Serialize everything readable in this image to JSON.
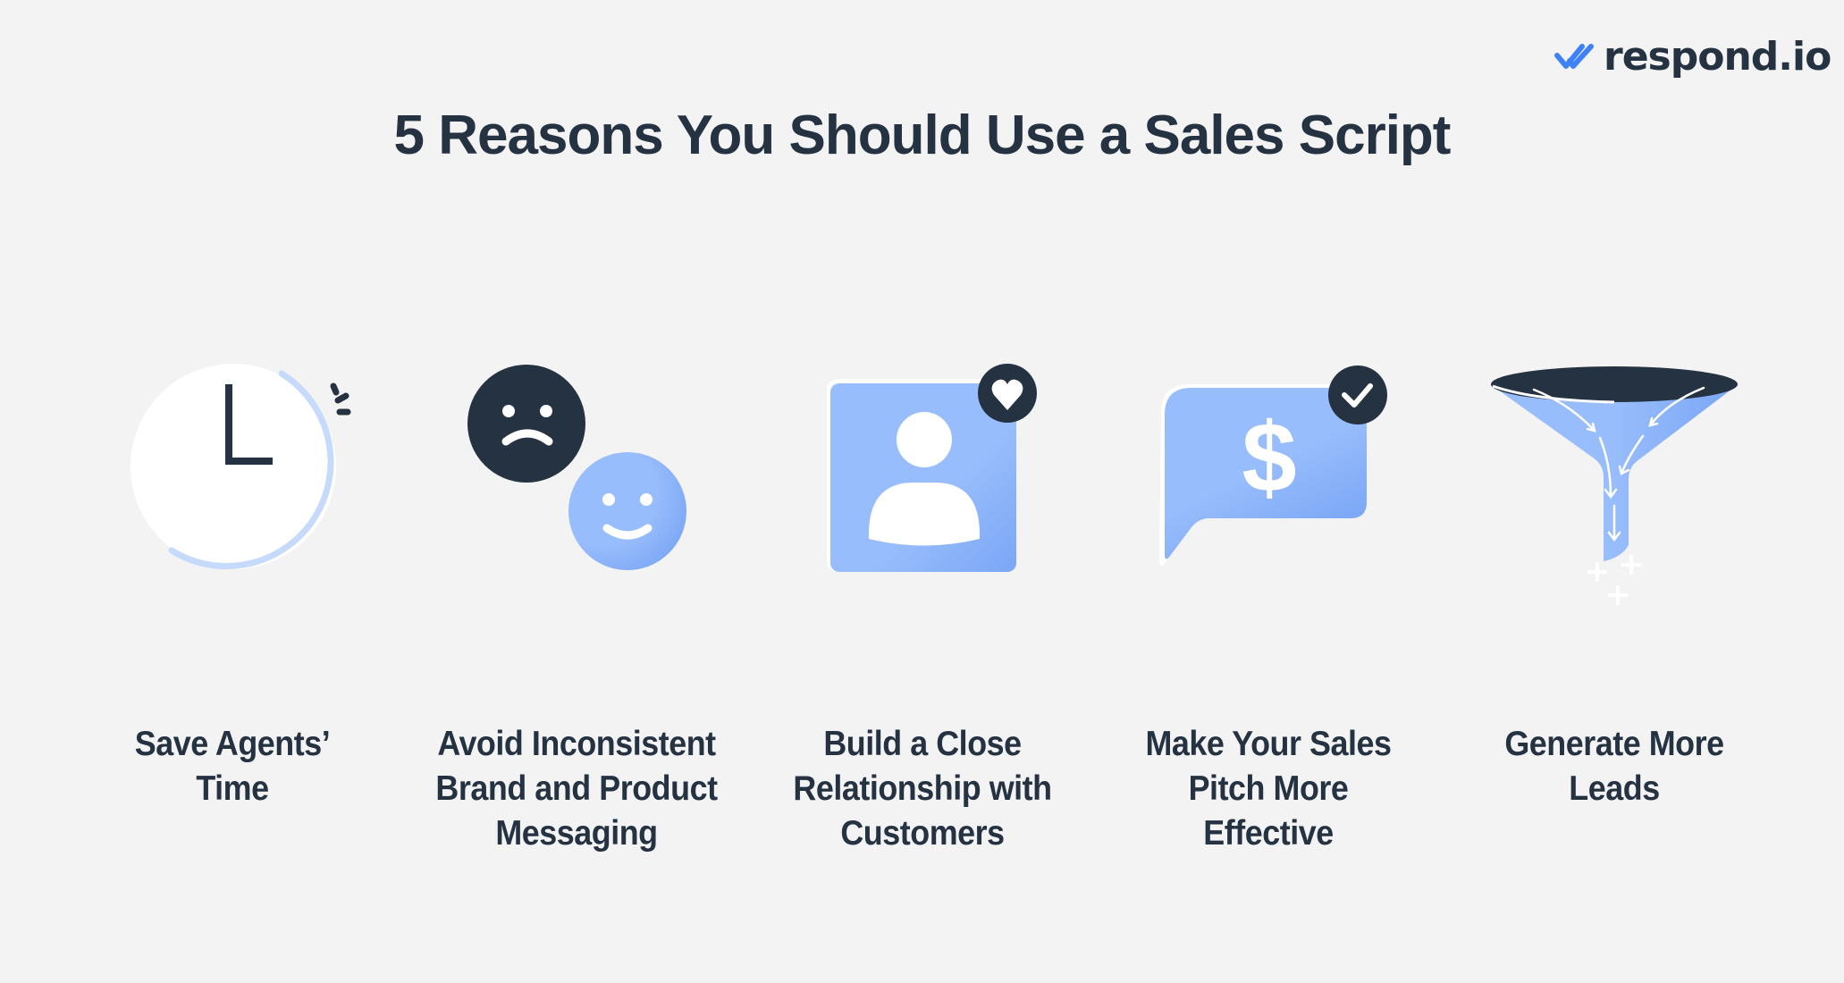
{
  "brand": {
    "name": "respond.io",
    "logo_icon": "double-check-icon",
    "accent_color": "#3f82f7",
    "dark_color": "#253242",
    "light_blue": "#98bdfc"
  },
  "title": "5 Reasons You Should Use a Sales Script",
  "reasons": [
    {
      "icon": "clock-icon",
      "lines": [
        "Save Agents’",
        "Time"
      ]
    },
    {
      "icon": "sad-happy-faces-icon",
      "lines": [
        "Avoid Inconsistent",
        "Brand and Product",
        "Messaging"
      ]
    },
    {
      "icon": "contact-card-heart-icon",
      "lines": [
        "Build a Close",
        "Relationship with",
        "Customers"
      ]
    },
    {
      "icon": "dollar-chat-bubble-check-icon",
      "lines": [
        "Make Your Sales",
        "Pitch More",
        "Effective"
      ]
    },
    {
      "icon": "funnel-icon",
      "lines": [
        "Generate More",
        "Leads"
      ]
    }
  ]
}
